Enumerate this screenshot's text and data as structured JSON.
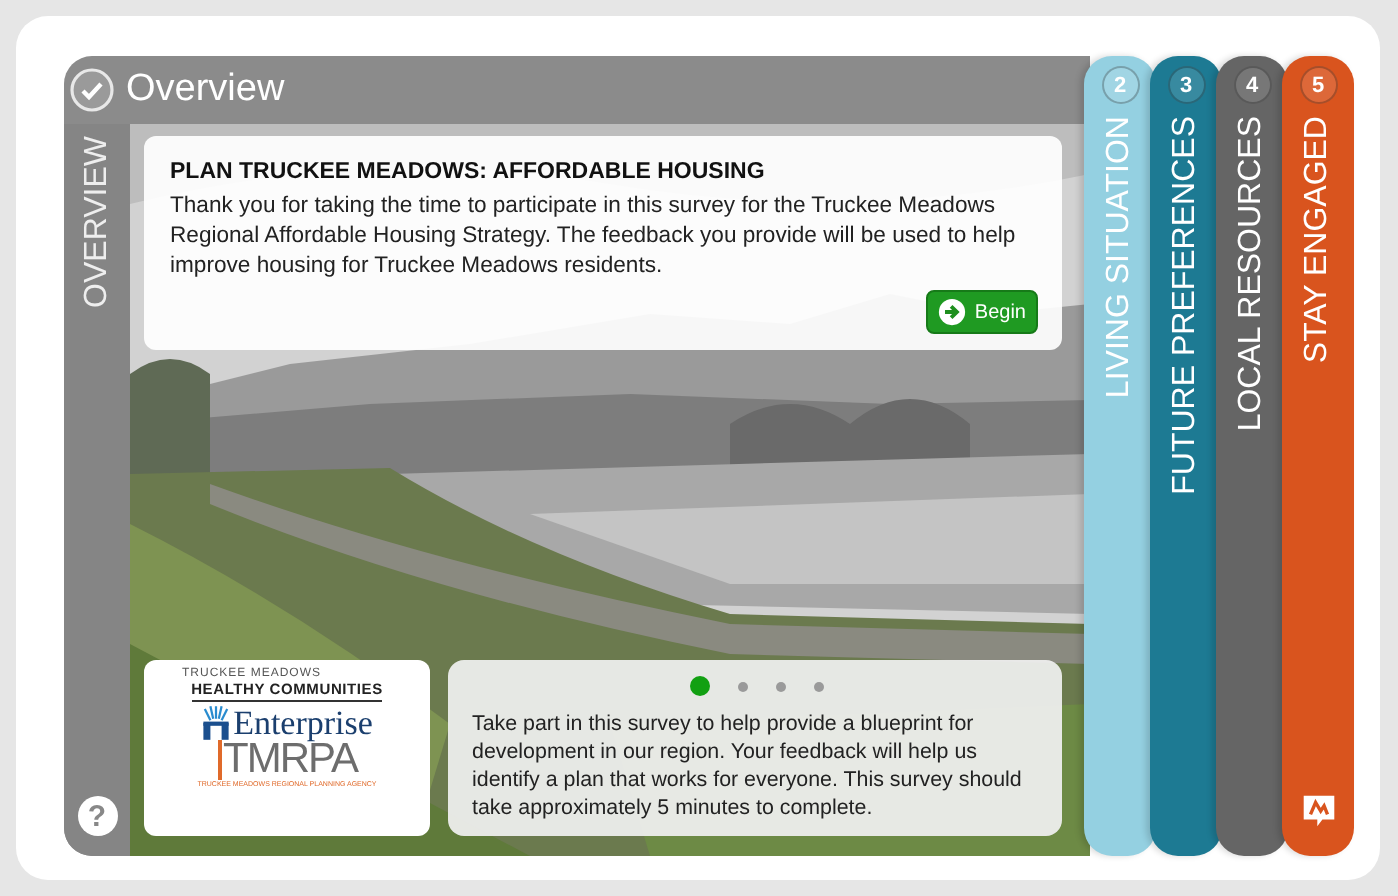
{
  "header": {
    "title": "Overview",
    "completed": true
  },
  "side_label": "OVERVIEW",
  "intro": {
    "title": "PLAN TRUCKEE MEADOWS: AFFORDABLE HOUSING",
    "body": "Thank you for taking the time to participate in this survey for the Truckee Meadows Regional Affordable Housing Strategy. The feedback you provide will be used to help improve housing for Truckee Meadows residents.",
    "button": "Begin"
  },
  "logos": {
    "top_small": "TRUCKEE MEADOWS",
    "top_bold": "HEALTHY COMMUNITIES",
    "enterprise": "Enterprise",
    "tmrpa": "TMRPA",
    "tmrpa_caption": "TRUCKEE MEADOWS REGIONAL PLANNING AGENCY"
  },
  "carousel": {
    "dots": [
      {
        "selected": true
      },
      {
        "selected": false
      },
      {
        "selected": false
      },
      {
        "selected": false
      }
    ],
    "text": "Take part in this survey to help provide a blueprint for development in our region. Your feedback will help us identify a plan that works for everyone. This survey should take approximately 5 minutes to complete."
  },
  "help": "?",
  "tabs": [
    {
      "number": "2",
      "label": "LIVING SITUATION",
      "color": "#94d0e1"
    },
    {
      "number": "3",
      "label": "FUTURE PREFERENCES",
      "color": "#1d7a93"
    },
    {
      "number": "4",
      "label": "LOCAL RESOURCES",
      "color": "#656565"
    },
    {
      "number": "5",
      "label": "STAY ENGAGED",
      "color": "#d9541e"
    }
  ]
}
